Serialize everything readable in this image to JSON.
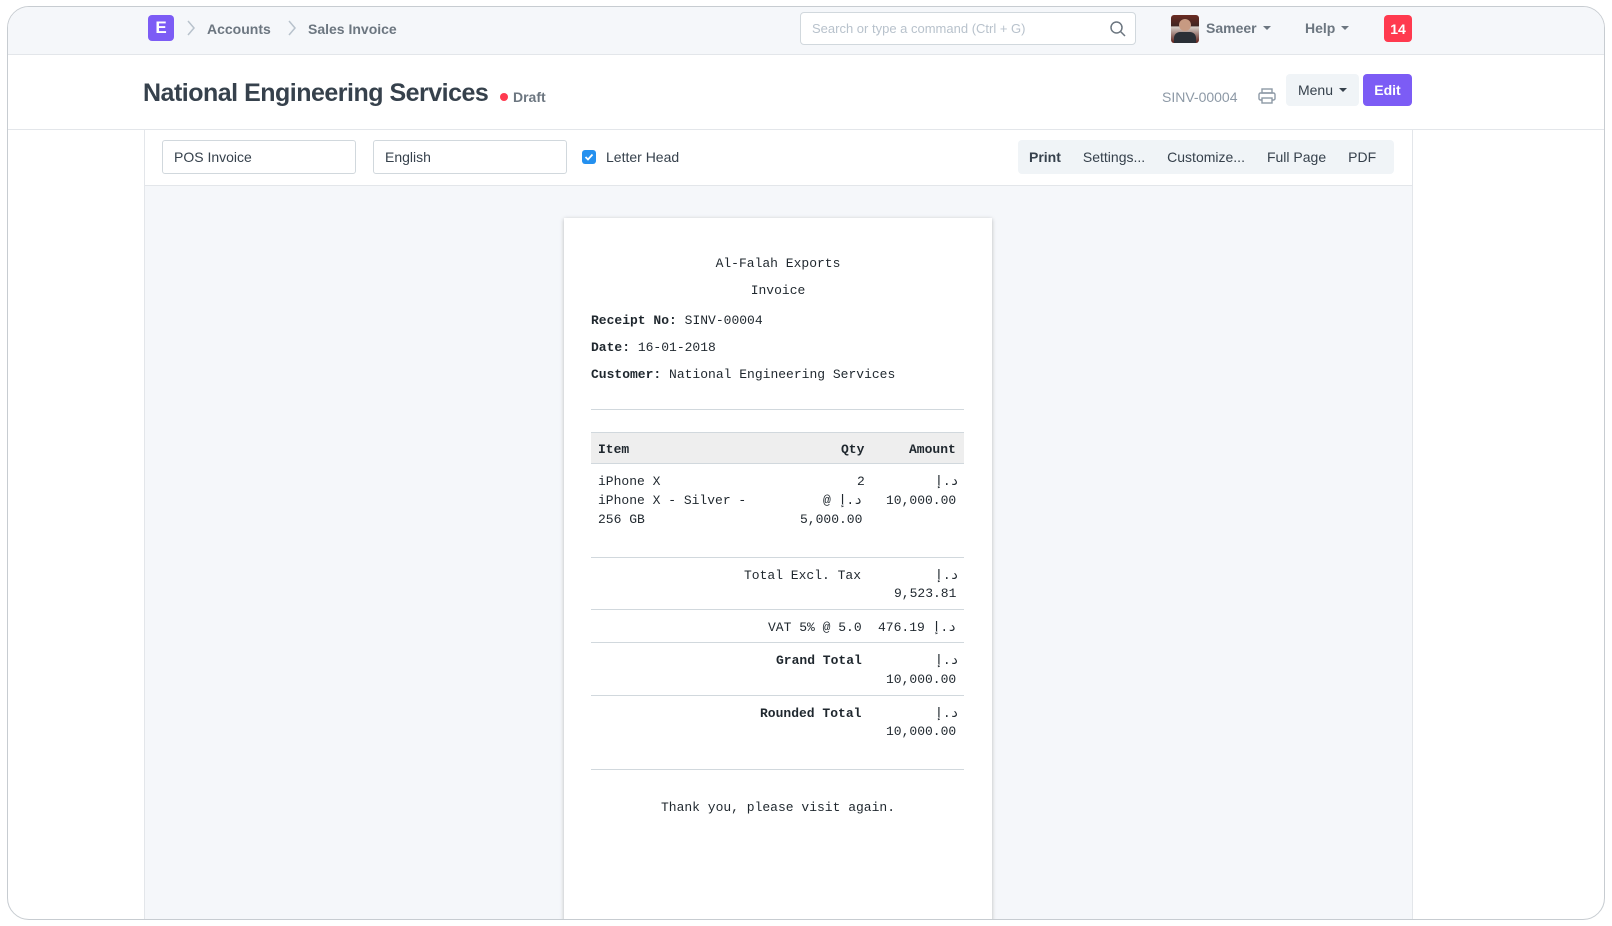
{
  "navbar": {
    "logo_letter": "E",
    "breadcrumbs": [
      "Accounts",
      "Sales Invoice"
    ],
    "search_placeholder": "Search or type a command (Ctrl + G)",
    "user_name": "Sameer",
    "help_label": "Help",
    "notification_count": "14"
  },
  "page": {
    "title": "National Engineering Services",
    "status": "Draft",
    "doc_id": "SINV-00004",
    "menu_label": "Menu",
    "edit_label": "Edit"
  },
  "toolbar": {
    "print_format": "POS Invoice",
    "language": "English",
    "letter_head_label": "Letter Head",
    "letter_head_checked": true,
    "buttons": [
      "Print",
      "Settings...",
      "Customize...",
      "Full Page",
      "PDF"
    ]
  },
  "receipt": {
    "company": "Al-Falah Exports",
    "doc_type": "Invoice",
    "receipt_no_label": "Receipt No:",
    "receipt_no": "SINV-00004",
    "date_label": "Date:",
    "date": "16-01-2018",
    "customer_label": "Customer:",
    "customer": "National Engineering Services",
    "headers": {
      "item": "Item",
      "qty": "Qty",
      "amount": "Amount"
    },
    "item": {
      "line1": "iPhone X",
      "line2": "iPhone X - Silver -",
      "line3": "256 GB",
      "qty": "2",
      "rate_prefix": "@ د.إ",
      "rate": "5,000.00",
      "currency": "د.إ",
      "amount": "10,000.00"
    },
    "totals": {
      "excl_label": "Total Excl. Tax",
      "excl_currency": "د.إ",
      "excl_value": "9,523.81",
      "vat_label": "VAT 5% @ 5.0",
      "vat_value": "476.19 د.إ",
      "grand_label": "Grand Total",
      "grand_currency": "د.إ",
      "grand_value": "10,000.00",
      "rounded_label": "Rounded Total",
      "rounded_currency": "د.إ",
      "rounded_value": "10,000.00"
    },
    "footer": "Thank you, please visit again."
  },
  "colors": {
    "accent": "#7c5cf5",
    "notification": "#ff3a4f",
    "checkbox": "#2490ef"
  }
}
